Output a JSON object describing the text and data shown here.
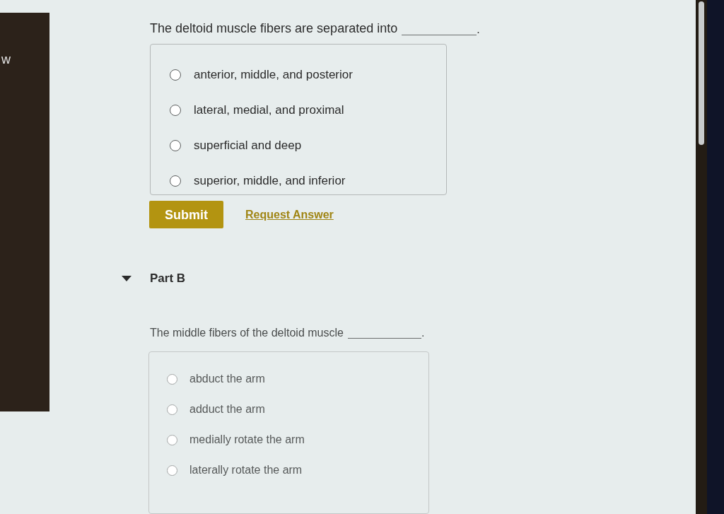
{
  "side_panel": {
    "text": "w"
  },
  "part_a": {
    "question": {
      "prompt": "The deltoid muscle fibers are separated into",
      "suffix": "."
    },
    "options": [
      {
        "label": "anterior, middle, and posterior",
        "selected": false
      },
      {
        "label": "lateral, medial, and proximal",
        "selected": false
      },
      {
        "label": "superficial and deep",
        "selected": false
      },
      {
        "label": "superior, middle, and inferior",
        "selected": false
      }
    ],
    "submit": "Submit",
    "request_answer": "Request Answer"
  },
  "part_b": {
    "expanded": true,
    "title": "Part B",
    "question": {
      "prompt": "The middle fibers of the deltoid muscle",
      "suffix": "."
    },
    "options": [
      {
        "label": "abduct the arm",
        "selected": false
      },
      {
        "label": "adduct the arm",
        "selected": false
      },
      {
        "label": "medially rotate the arm",
        "selected": false
      },
      {
        "label": "laterally rotate the arm",
        "selected": false
      }
    ]
  }
}
